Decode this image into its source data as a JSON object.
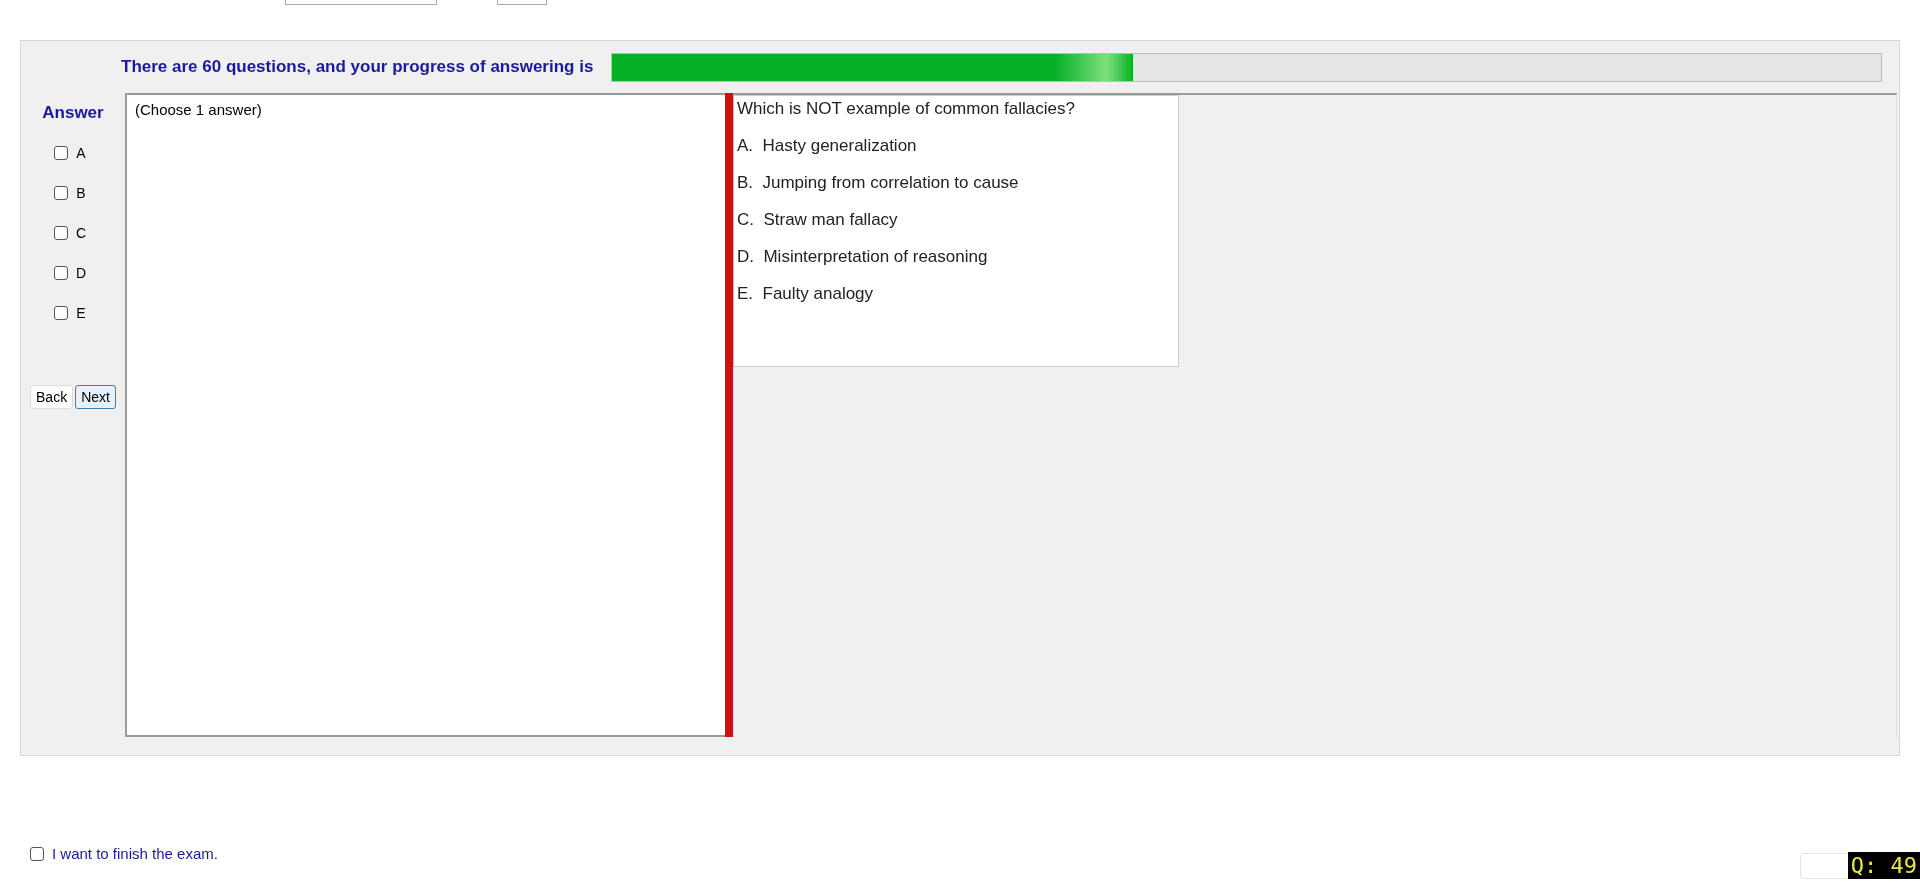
{
  "progress": {
    "label": "There are 60 questions, and your progress of answering is",
    "level": 0.41
  },
  "answer_panel": {
    "title": "Answer",
    "options": [
      {
        "label": "A",
        "checked": false
      },
      {
        "label": "B",
        "checked": false
      },
      {
        "label": "C",
        "checked": false
      },
      {
        "label": "D",
        "checked": false
      },
      {
        "label": "E",
        "checked": false
      }
    ]
  },
  "buttons": [
    {
      "label": "Back",
      "selected": false
    },
    {
      "label": "Next",
      "selected": true
    }
  ],
  "answer_area": {
    "hint": "(Choose 1 answer)"
  },
  "question": {
    "text": "Which is NOT example of common fallacies?",
    "choices": [
      {
        "letter": "A.",
        "text": "Hasty generalization"
      },
      {
        "letter": "B.",
        "text": "Jumping from correlation to cause"
      },
      {
        "letter": "C.",
        "text": "Straw man fallacy"
      },
      {
        "letter": "D.",
        "text": "Misinterpretation of reasoning"
      },
      {
        "letter": "E.",
        "text": "Faulty analogy"
      }
    ]
  },
  "finish": {
    "label": "I want to finish the exam.",
    "checked": false
  },
  "question_badge": "Q: 49"
}
